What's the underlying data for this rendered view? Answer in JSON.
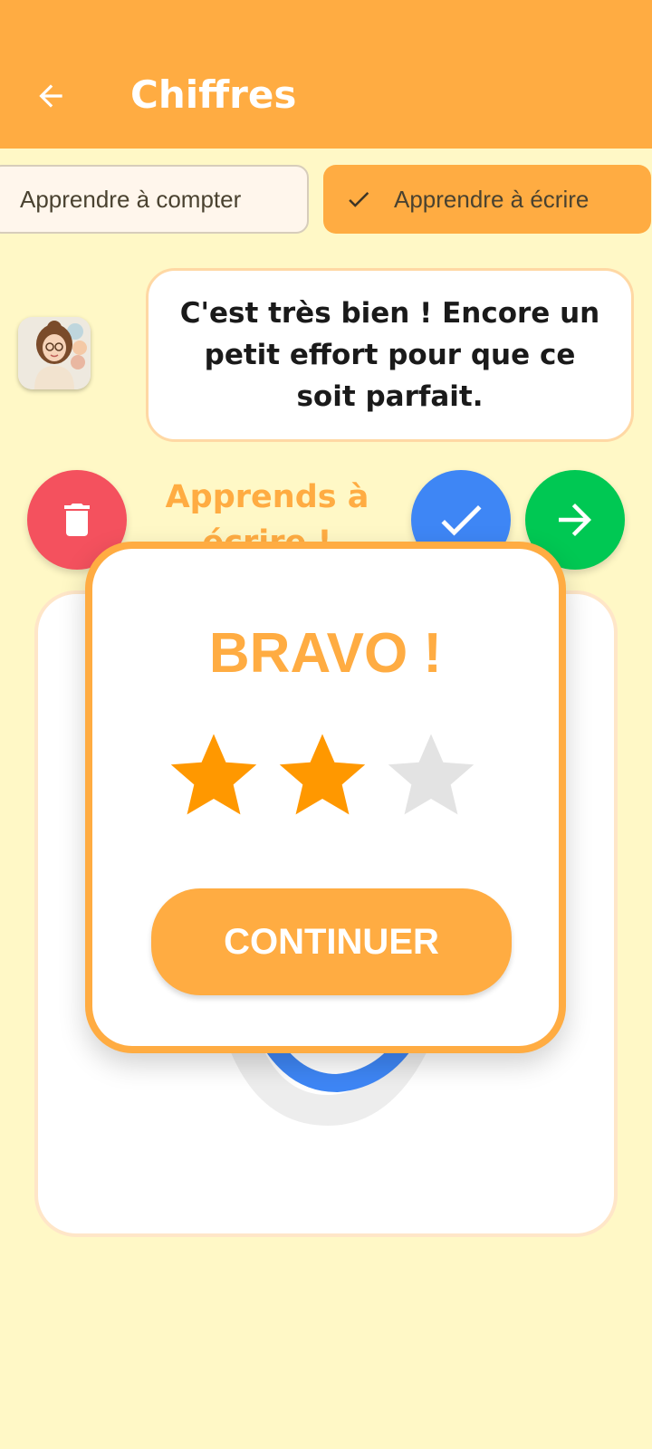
{
  "header": {
    "title": "Chiffres",
    "back_icon": "arrow-left-icon",
    "background_color": "#FFAC42"
  },
  "tabs": [
    {
      "label": "Apprendre à compter",
      "selected": false
    },
    {
      "label": "Apprendre à écrire",
      "selected": true,
      "icon": "check-icon"
    }
  ],
  "tutor": {
    "avatar_icon": "teacher-avatar-icon",
    "message": "C'est très bien ! Encore un petit effort pour que ce soit parfait."
  },
  "actions": {
    "prompt": "Apprends à écrire !",
    "delete_icon": "trash-icon",
    "validate_icon": "check-icon",
    "next_icon": "arrow-right-icon",
    "delete_color": "#F4515E",
    "validate_color": "#3E86F5",
    "next_color": "#00C853"
  },
  "result_dialog": {
    "title": "BRAVO !",
    "stars_earned": 2,
    "stars_total": 3,
    "continue_label": "CONTINUER",
    "accent_color": "#FFAC42",
    "star_color": "#FF9800",
    "star_empty_color": "#E3E3E3"
  },
  "page": {
    "background_color": "#FFF8C6"
  }
}
